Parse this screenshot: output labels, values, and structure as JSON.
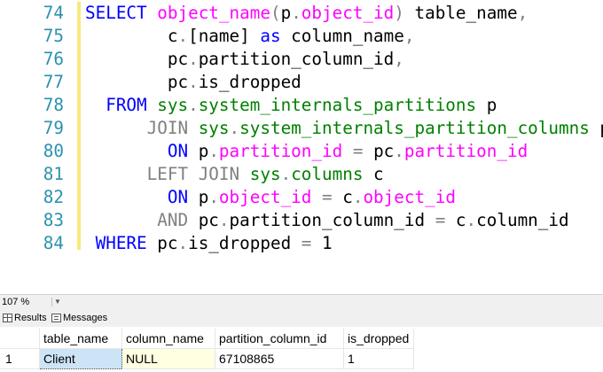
{
  "editor": {
    "lines": [
      {
        "num": "74",
        "indent": "",
        "tokens": [
          {
            "t": "SELECT ",
            "c": "kw"
          },
          {
            "t": "object_name",
            "c": "fn"
          },
          {
            "t": "(",
            "c": "gr"
          },
          {
            "t": "p",
            "c": "txt"
          },
          {
            "t": ".",
            "c": "gr"
          },
          {
            "t": "object_id",
            "c": "fn"
          },
          {
            "t": ")",
            "c": "gr"
          },
          {
            "t": " table_name",
            "c": "txt"
          },
          {
            "t": ",",
            "c": "gr"
          }
        ]
      },
      {
        "num": "75",
        "indent": "        ",
        "tokens": [
          {
            "t": "c",
            "c": "txt"
          },
          {
            "t": ".",
            "c": "gr"
          },
          {
            "t": "[name] ",
            "c": "txt"
          },
          {
            "t": "as",
            "c": "kw"
          },
          {
            "t": " column_name",
            "c": "txt"
          },
          {
            "t": ",",
            "c": "gr"
          }
        ]
      },
      {
        "num": "76",
        "indent": "        ",
        "tokens": [
          {
            "t": "pc",
            "c": "txt"
          },
          {
            "t": ".",
            "c": "gr"
          },
          {
            "t": "partition_column_id",
            "c": "txt"
          },
          {
            "t": ",",
            "c": "gr"
          }
        ]
      },
      {
        "num": "77",
        "indent": "        ",
        "tokens": [
          {
            "t": "pc",
            "c": "txt"
          },
          {
            "t": ".",
            "c": "gr"
          },
          {
            "t": "is_dropped",
            "c": "txt"
          }
        ]
      },
      {
        "num": "78",
        "indent": "  ",
        "tokens": [
          {
            "t": "FROM ",
            "c": "kw"
          },
          {
            "t": "sys",
            "c": "sys"
          },
          {
            "t": ".",
            "c": "gr"
          },
          {
            "t": "system_internals_partitions",
            "c": "sys"
          },
          {
            "t": " p",
            "c": "txt"
          }
        ]
      },
      {
        "num": "79",
        "indent": "      ",
        "tokens": [
          {
            "t": "JOIN ",
            "c": "gr"
          },
          {
            "t": "sys",
            "c": "sys"
          },
          {
            "t": ".",
            "c": "gr"
          },
          {
            "t": "system_internals_partition_columns",
            "c": "sys"
          },
          {
            "t": " pc",
            "c": "txt"
          }
        ]
      },
      {
        "num": "80",
        "indent": "        ",
        "tokens": [
          {
            "t": "ON ",
            "c": "kw"
          },
          {
            "t": "p",
            "c": "txt"
          },
          {
            "t": ".",
            "c": "gr"
          },
          {
            "t": "partition_id",
            "c": "fn"
          },
          {
            "t": " = ",
            "c": "gr"
          },
          {
            "t": "pc",
            "c": "txt"
          },
          {
            "t": ".",
            "c": "gr"
          },
          {
            "t": "partition_id",
            "c": "fn"
          }
        ]
      },
      {
        "num": "81",
        "indent": "      ",
        "tokens": [
          {
            "t": "LEFT JOIN ",
            "c": "gr"
          },
          {
            "t": "sys",
            "c": "sys"
          },
          {
            "t": ".",
            "c": "gr"
          },
          {
            "t": "columns",
            "c": "sys"
          },
          {
            "t": " c",
            "c": "txt"
          }
        ]
      },
      {
        "num": "82",
        "indent": "        ",
        "tokens": [
          {
            "t": "ON ",
            "c": "kw"
          },
          {
            "t": "p",
            "c": "txt"
          },
          {
            "t": ".",
            "c": "gr"
          },
          {
            "t": "object_id",
            "c": "fn"
          },
          {
            "t": " = ",
            "c": "gr"
          },
          {
            "t": "c",
            "c": "txt"
          },
          {
            "t": ".",
            "c": "gr"
          },
          {
            "t": "object_id",
            "c": "fn"
          }
        ]
      },
      {
        "num": "83",
        "indent": "       ",
        "tokens": [
          {
            "t": "AND ",
            "c": "gr"
          },
          {
            "t": "pc",
            "c": "txt"
          },
          {
            "t": ".",
            "c": "gr"
          },
          {
            "t": "partition_column_id",
            "c": "txt"
          },
          {
            "t": " = ",
            "c": "gr"
          },
          {
            "t": "c",
            "c": "txt"
          },
          {
            "t": ".",
            "c": "gr"
          },
          {
            "t": "column_id",
            "c": "txt"
          }
        ]
      },
      {
        "num": "84",
        "indent": " ",
        "tokens": [
          {
            "t": "WHERE ",
            "c": "kw"
          },
          {
            "t": "pc",
            "c": "txt"
          },
          {
            "t": ".",
            "c": "gr"
          },
          {
            "t": "is_dropped",
            "c": "txt"
          },
          {
            "t": " = ",
            "c": "gr"
          },
          {
            "t": "1",
            "c": "txt"
          }
        ]
      }
    ]
  },
  "zoom": {
    "value": "107 %"
  },
  "tabs": {
    "results": "Results",
    "messages": "Messages"
  },
  "results": {
    "columns": [
      "table_name",
      "column_name",
      "partition_column_id",
      "is_dropped"
    ],
    "rows": [
      {
        "num": "1",
        "cells": [
          "Client",
          "NULL",
          "67108865",
          "1"
        ]
      }
    ]
  },
  "colors": {
    "keyword": "#0000ff",
    "function": "#ff00ff",
    "system_object": "#008000",
    "operator": "#808080",
    "line_number": "#2b91af",
    "change_bar": "#f7e97c"
  }
}
